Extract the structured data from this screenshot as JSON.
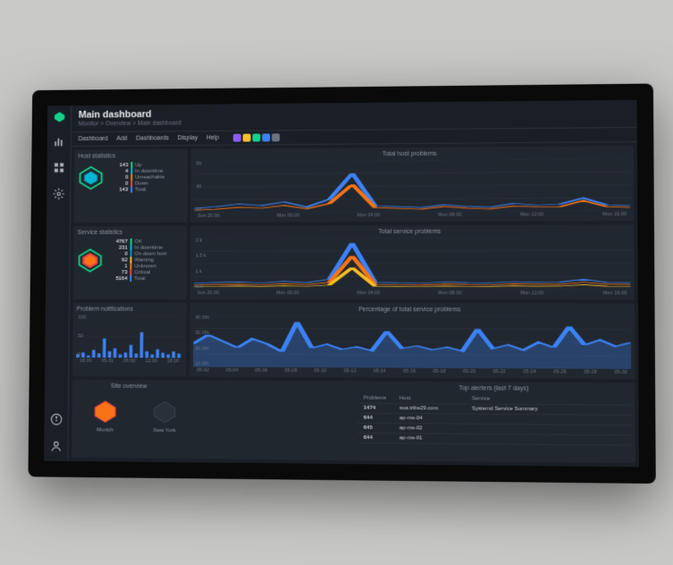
{
  "header": {
    "title": "Main dashboard",
    "breadcrumb": "Monitor > Overview > Main dashboard"
  },
  "toolbar": {
    "items": [
      "Dashboard",
      "Add",
      "Dashboards",
      "Display",
      "Help"
    ],
    "badge_colors": [
      "#8b5cf6",
      "#fbbf24",
      "#13d389",
      "#3b82f6",
      "#6b7280"
    ]
  },
  "host_stats": {
    "title": "Host statistics",
    "items": [
      {
        "count": "143",
        "color": "#13d389",
        "label": "Up"
      },
      {
        "count": "4",
        "color": "#06b6d4",
        "label": "In downtime"
      },
      {
        "count": "0",
        "color": "#f97316",
        "label": "Unreachable"
      },
      {
        "count": "0",
        "color": "#ef4444",
        "label": "Down"
      },
      {
        "count": "143",
        "color": "#3b82f6",
        "label": "Total"
      }
    ]
  },
  "service_stats": {
    "title": "Service statistics",
    "items": [
      {
        "count": "4767",
        "color": "#13d389",
        "label": "OK"
      },
      {
        "count": "231",
        "color": "#06b6d4",
        "label": "In downtime"
      },
      {
        "count": "0",
        "color": "#0891b2",
        "label": "On down host"
      },
      {
        "count": "92",
        "color": "#fbbf24",
        "label": "Warning"
      },
      {
        "count": "1",
        "color": "#f97316",
        "label": "Unknown"
      },
      {
        "count": "73",
        "color": "#ef4444",
        "label": "Critical"
      },
      {
        "count": "5164",
        "color": "#3b82f6",
        "label": "Total"
      }
    ]
  },
  "notif": {
    "title": "Problem notifications",
    "ylabels": [
      "100",
      "50",
      "0"
    ],
    "xlabels": [
      "18:00",
      "05-31",
      "06:00",
      "12:00",
      "18:00"
    ]
  },
  "chart_data": [
    {
      "type": "line",
      "title": "Total host problems",
      "ylim": [
        0,
        60
      ],
      "ylabels": [
        "60",
        "40",
        "20"
      ],
      "x_categories": [
        "Sun 20:00",
        "Mon 00:00",
        "Mon 04:00",
        "Mon 08:00",
        "Mon 12:00",
        "Mon 16:00"
      ],
      "series": [
        {
          "name": "blue",
          "color": "#3b82f6",
          "values": [
            5,
            7,
            10,
            8,
            12,
            6,
            15,
            45,
            7,
            6,
            5,
            8,
            6,
            5,
            9,
            7,
            8,
            15,
            7,
            6
          ]
        },
        {
          "name": "orange",
          "color": "#f97316",
          "values": [
            3,
            4,
            6,
            5,
            8,
            4,
            10,
            32,
            5,
            4,
            3,
            6,
            4,
            3,
            6,
            5,
            5,
            12,
            5,
            4
          ]
        }
      ]
    },
    {
      "type": "line",
      "title": "Total service problems",
      "ylim": [
        0,
        2000
      ],
      "ylabels": [
        "2 k",
        "1.5 k",
        "1 k",
        "500"
      ],
      "x_categories": [
        "Sun 20:00",
        "Mon 00:00",
        "Mon 04:00",
        "Mon 08:00",
        "Mon 12:00",
        "Mon 16:00"
      ],
      "series": [
        {
          "name": "blue",
          "color": "#3b82f6",
          "values": [
            250,
            280,
            300,
            260,
            320,
            270,
            400,
            1800,
            280,
            260,
            250,
            300,
            270,
            260,
            310,
            280,
            290,
            400,
            280,
            270
          ]
        },
        {
          "name": "orange",
          "color": "#f97316",
          "values": [
            180,
            200,
            210,
            190,
            230,
            200,
            280,
            1300,
            200,
            190,
            180,
            220,
            200,
            190,
            230,
            210,
            210,
            290,
            210,
            200
          ]
        },
        {
          "name": "yellow",
          "color": "#fbbf24",
          "values": [
            120,
            130,
            140,
            125,
            150,
            130,
            180,
            850,
            130,
            125,
            120,
            145,
            130,
            125,
            150,
            135,
            140,
            190,
            135,
            130
          ]
        }
      ]
    },
    {
      "type": "area",
      "title": "Percentage of total service problems",
      "ylim": [
        0,
        40
      ],
      "ylabels": [
        "40.0%",
        "30.0%",
        "20.0%",
        "10.0%"
      ],
      "x_categories": [
        "05-02",
        "05-04",
        "05-06",
        "05-08",
        "05-10",
        "05-12",
        "05-14",
        "05-16",
        "05-18",
        "05-20",
        "05-22",
        "05-24",
        "05-26",
        "05-28",
        "05-30"
      ],
      "series": [
        {
          "name": "pct",
          "color": "#3b82f6",
          "values": [
            18,
            25,
            20,
            15,
            22,
            18,
            12,
            35,
            15,
            18,
            14,
            16,
            13,
            28,
            15,
            17,
            14,
            16,
            13,
            30,
            15,
            18,
            14,
            20,
            16,
            32,
            18,
            22,
            17,
            20
          ]
        }
      ]
    }
  ],
  "sites": {
    "title": "Site overview",
    "items": [
      {
        "name": "Munich",
        "color": "#f97316",
        "active": true
      },
      {
        "name": "New York",
        "color": "#374151",
        "active": false
      }
    ]
  },
  "alerters": {
    "title": "Top alerters (last 7 days)",
    "headers": {
      "problems": "Problems",
      "host": "Host",
      "service": "Service"
    },
    "rows": [
      {
        "problems": "1474",
        "host": "soa.tribe29.com",
        "service": "Systemd Service Summary"
      },
      {
        "problems": "644",
        "host": "ap-ms-04",
        "service": ""
      },
      {
        "problems": "645",
        "host": "ap-ms-02",
        "service": ""
      },
      {
        "problems": "644",
        "host": "ap-ms-01",
        "service": ""
      }
    ]
  }
}
